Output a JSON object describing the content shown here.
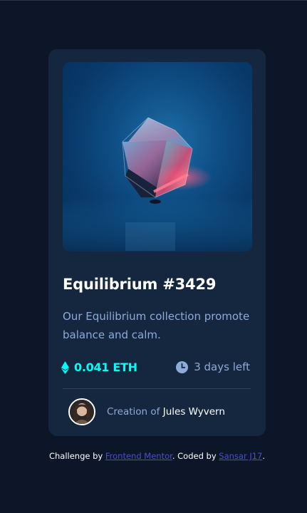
{
  "card": {
    "image_alt": "Equilibrium",
    "title": "Equilibrium #3429",
    "description": "Our Equilibrium collection promote balance and calm.",
    "price": "0.041 ETH",
    "price_icon": "ethereum-icon",
    "time_left": "3 days left",
    "time_icon": "clock-icon",
    "creator_prefix": "Creation of",
    "creator_name": "Jules Wyvern"
  },
  "attribution": {
    "prefix": "Challenge by",
    "frontend_mentor": "Frontend Mentor",
    "middle": ". Coded by",
    "author": "Sansar J17",
    "suffix": "."
  },
  "colors": {
    "page_bg": "#0d1628",
    "card_bg": "#15263f",
    "accent_cyan": "#00fff8",
    "soft_blue": "#8bacd9",
    "link": "#4a4fd1"
  }
}
